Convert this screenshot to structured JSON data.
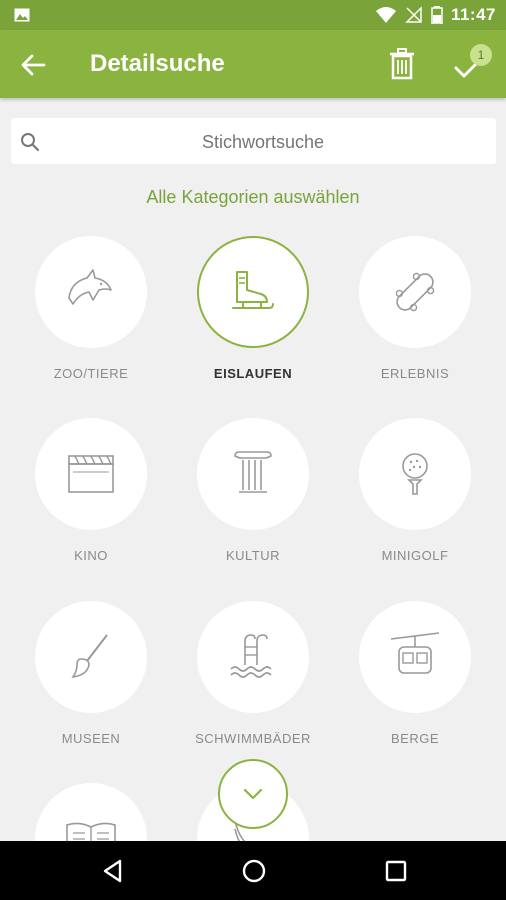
{
  "status_bar": {
    "time": "11:47"
  },
  "app_bar": {
    "title": "Detailsuche",
    "badge_count": "1",
    "accent_color": "#8bb33f"
  },
  "search": {
    "placeholder": "Stichwortsuche"
  },
  "select_all_label": "Alle Kategorien auswählen",
  "categories": [
    {
      "label": "ZOO/TIERE",
      "icon": "dolphin-icon",
      "selected": false
    },
    {
      "label": "EISLAUFEN",
      "icon": "ice-skate-icon",
      "selected": true
    },
    {
      "label": "ERLEBNIS",
      "icon": "skateboard-icon",
      "selected": false
    },
    {
      "label": "KINO",
      "icon": "clapperboard-icon",
      "selected": false
    },
    {
      "label": "KULTUR",
      "icon": "column-icon",
      "selected": false
    },
    {
      "label": "MINIGOLF",
      "icon": "golf-ball-icon",
      "selected": false
    },
    {
      "label": "MUSEEN",
      "icon": "paintbrush-icon",
      "selected": false
    },
    {
      "label": "SCHWIMMBÄDER",
      "icon": "pool-icon",
      "selected": false
    },
    {
      "label": "BERGE",
      "icon": "cable-car-icon",
      "selected": false
    },
    {
      "label": "",
      "icon": "book-icon",
      "selected": false
    },
    {
      "label": "",
      "icon": "slide-icon",
      "selected": false
    }
  ]
}
